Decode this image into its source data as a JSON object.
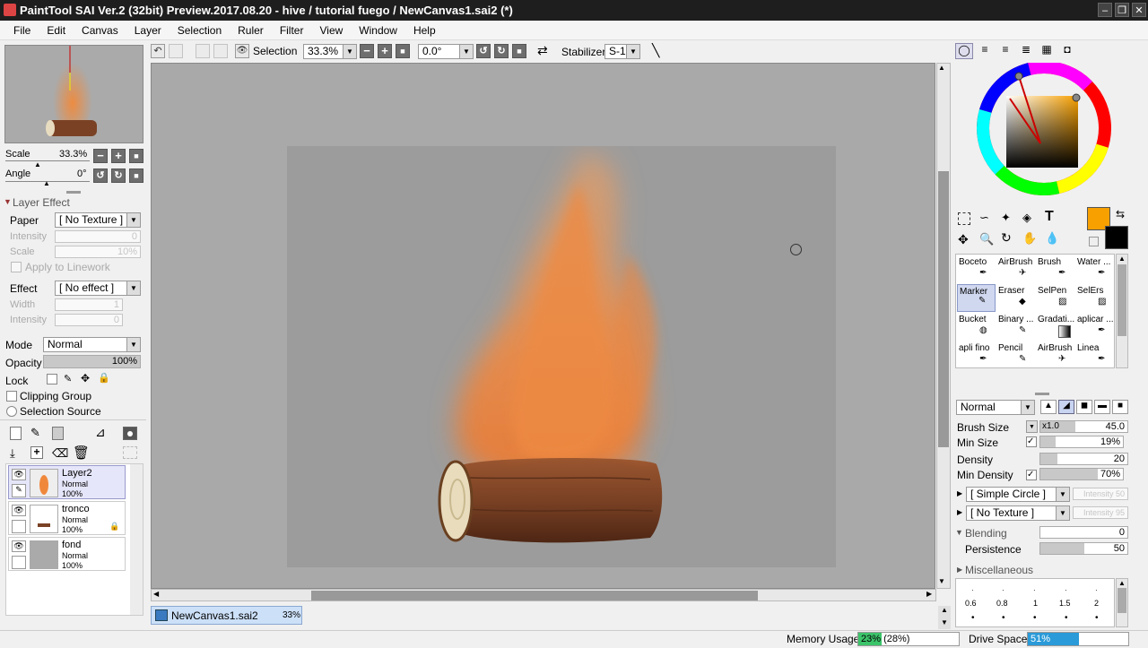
{
  "window": {
    "title": "PaintTool SAI Ver.2 (32bit) Preview.2017.08.20 - hive / tutorial fuego / NewCanvas1.sai2 (*)"
  },
  "menu": [
    "File",
    "Edit",
    "Canvas",
    "Layer",
    "Selection",
    "Ruler",
    "Filter",
    "View",
    "Window",
    "Help"
  ],
  "navigator": {
    "scale_label": "Scale",
    "scale_value": "33.3%",
    "angle_label": "Angle",
    "angle_value": "0°"
  },
  "layer_effect": {
    "header": "Layer Effect",
    "paper_label": "Paper",
    "paper_value": "[ No Texture ]",
    "intensity_label": "Intensity",
    "intensity_value": "0",
    "scale_label": "Scale",
    "scale_value": "10%",
    "apply_linework": "Apply to Linework",
    "effect_label": "Effect",
    "effect_value": "[ No effect ]",
    "width_label": "Width",
    "width_value": "1",
    "intensity2_label": "Intensity",
    "intensity2_value": "0"
  },
  "layer_props": {
    "mode_label": "Mode",
    "mode_value": "Normal",
    "opacity_label": "Opacity",
    "opacity_value": "100%",
    "lock_label": "Lock",
    "clipping_group": "Clipping Group",
    "selection_source": "Selection Source"
  },
  "layers": [
    {
      "name": "Layer2",
      "mode": "Normal",
      "opacity": "100%"
    },
    {
      "name": "tronco",
      "mode": "Normal",
      "opacity": "100%"
    },
    {
      "name": "fond",
      "mode": "Normal",
      "opacity": "100%"
    }
  ],
  "canvas_toolbar": {
    "selection_label": "Selection",
    "zoom_value": "33.3%",
    "angle_value": "0.0°",
    "stabilizer_label": "Stabilizer",
    "stabilizer_value": "S-1"
  },
  "tools": [
    {
      "name": "Boceto"
    },
    {
      "name": "AirBrush"
    },
    {
      "name": "Brush"
    },
    {
      "name": "Water ..."
    },
    {
      "name": "Marker",
      "selected": true
    },
    {
      "name": "Eraser"
    },
    {
      "name": "SelPen"
    },
    {
      "name": "SelErs"
    },
    {
      "name": "Bucket"
    },
    {
      "name": "Binary ..."
    },
    {
      "name": "Gradati..."
    },
    {
      "name": "aplicar ..."
    },
    {
      "name": "apli fino"
    },
    {
      "name": "Pencil"
    },
    {
      "name": "AirBrush"
    },
    {
      "name": "Linea"
    }
  ],
  "brush": {
    "mode_value": "Normal",
    "size_label": "Brush Size",
    "size_mult": "x1.0",
    "size_value": "45.0",
    "min_size_label": "Min Size",
    "min_size_value": "19%",
    "min_size_fraction": 0.19,
    "density_label": "Density",
    "density_value": "20",
    "density_fraction": 0.2,
    "min_density_label": "Min Density",
    "min_density_value": "70%",
    "min_density_fraction": 0.7,
    "shape_value": "[ Simple Circle ]",
    "shape_intensity": "Intensity 50",
    "texture_value": "[ No Texture ]",
    "texture_intensity": "Intensity 95",
    "blending_label": "Blending",
    "blending_value": "0",
    "persistence_label": "Persistence",
    "persistence_value": "50",
    "misc_label": "Miscellaneous",
    "dot_sizes": [
      "0.6",
      "0.8",
      "1",
      "1.5",
      "2"
    ]
  },
  "colors": {
    "primary": "#f7a000",
    "secondary": "#000000"
  },
  "document_tab": {
    "name": "NewCanvas1.sai2",
    "zoom": "33%"
  },
  "status": {
    "memory_label": "Memory Usage",
    "memory_value": "23% (28%)",
    "memory_fraction": 0.23,
    "drive_label": "Drive Space",
    "drive_value": "51%",
    "drive_fraction": 0.51
  }
}
